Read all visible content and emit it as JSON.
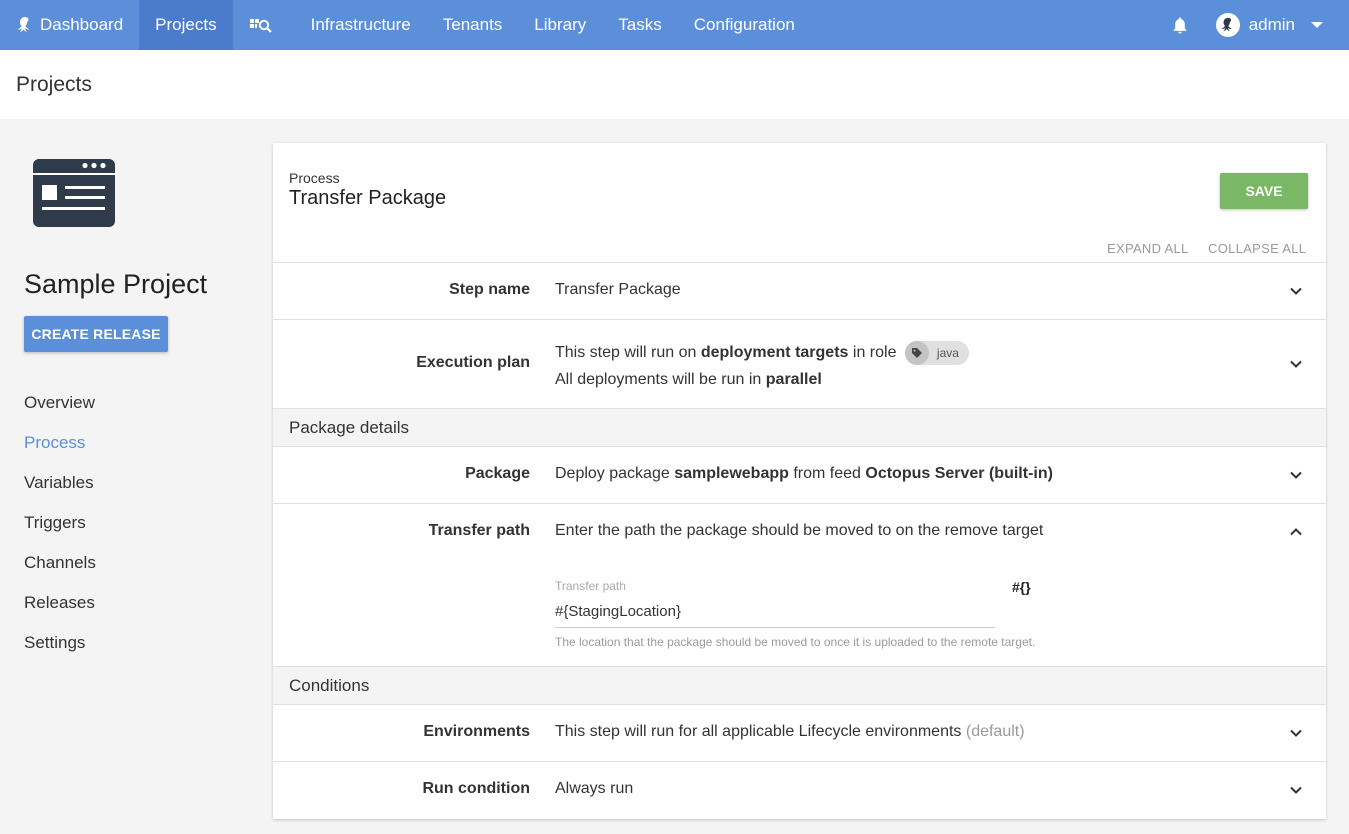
{
  "nav": {
    "items": [
      {
        "label": "Dashboard",
        "icon": "octopus-icon"
      },
      {
        "label": "Projects"
      },
      {
        "label": "",
        "icon": "search-grid-icon"
      },
      {
        "label": "Infrastructure"
      },
      {
        "label": "Tenants"
      },
      {
        "label": "Library"
      },
      {
        "label": "Tasks"
      },
      {
        "label": "Configuration"
      }
    ],
    "active": "Projects",
    "user": "admin"
  },
  "page": {
    "title": "Projects"
  },
  "sidebar": {
    "project_name": "Sample Project",
    "create_release": "CREATE RELEASE",
    "links": [
      "Overview",
      "Process",
      "Variables",
      "Triggers",
      "Channels",
      "Releases",
      "Settings"
    ],
    "active_link": "Process"
  },
  "card": {
    "breadcrumb": "Process",
    "title": "Transfer Package",
    "save": "SAVE",
    "expand_all": "EXPAND ALL",
    "collapse_all": "COLLAPSE ALL"
  },
  "rows": {
    "step_name": {
      "label": "Step name",
      "value": "Transfer Package"
    },
    "execution_plan": {
      "label": "Execution plan",
      "line1_a": "This step will run on ",
      "line1_b": "deployment targets",
      "line1_c": " in role",
      "role_tag": "java",
      "line2_a": "All deployments will be run in ",
      "line2_b": "parallel"
    },
    "package": {
      "label": "Package",
      "a": "Deploy package ",
      "b": "samplewebapp",
      "c": " from feed ",
      "d": "Octopus Server (built-in)"
    },
    "transfer_path": {
      "label": "Transfer path",
      "value": "Enter the path the package should be moved to on the remove target",
      "field_label": "Transfer path",
      "field_value": "#{StagingLocation}",
      "variable_button": "#{}",
      "hint": "The location that the package should be moved to once it is uploaded to the remote target."
    },
    "environments": {
      "label": "Environments",
      "value": "This step will run for all applicable Lifecycle environments",
      "suffix": "(default)"
    },
    "run_condition": {
      "label": "Run condition",
      "value": "Always run"
    }
  },
  "sections": {
    "package_details": "Package details",
    "conditions": "Conditions"
  },
  "colors": {
    "nav": "#5b8fd9",
    "nav_active": "#4a7ccb",
    "save": "#7bb865",
    "link_active": "#5b8fd9"
  }
}
